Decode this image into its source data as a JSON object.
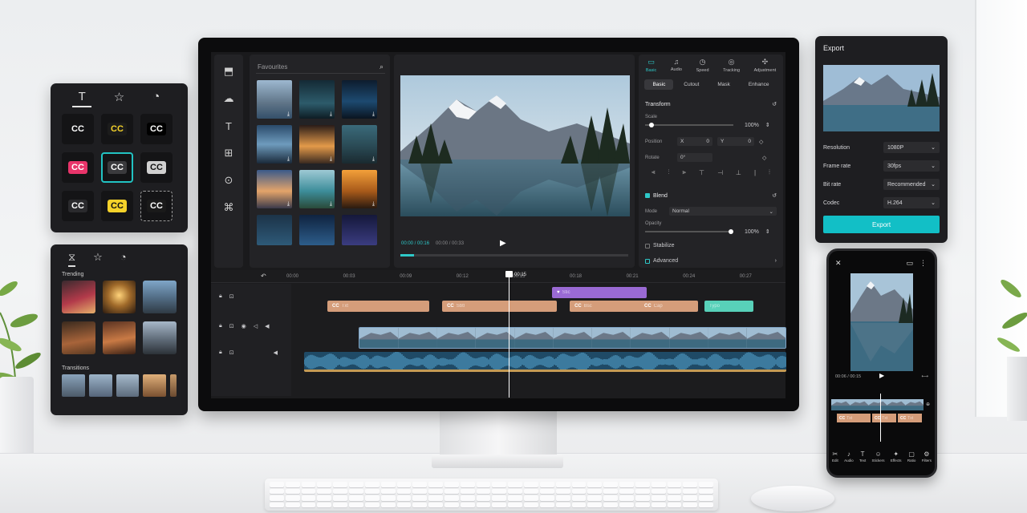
{
  "text_panel": {
    "tabs": [
      {
        "icon": "T"
      },
      {
        "icon": "☆"
      },
      {
        "icon": "◔"
      }
    ],
    "styles": [
      {
        "label": "CC",
        "bg": "#141416",
        "fg": "#ffffff"
      },
      {
        "label": "CC",
        "bg": "#1c1c1c",
        "fg": "#f5d22a"
      },
      {
        "label": "CC",
        "bg": "#000000",
        "fg": "#ffffff"
      },
      {
        "label": "CC",
        "bg": "#e8346a",
        "fg": "#ffffff"
      },
      {
        "label": "CC",
        "bg": "#3a3a3d",
        "fg": "#ffffff"
      },
      {
        "label": "CC",
        "bg": "#d0d0d0",
        "fg": "#111111"
      },
      {
        "label": "CC",
        "bg": "#2a2a2d",
        "fg": "#ffffff"
      },
      {
        "label": "CC",
        "bg": "#f5d22a",
        "fg": "#111111"
      },
      {
        "label": "CC",
        "bg": "#1a1a1a",
        "fg": "#ffffff"
      }
    ]
  },
  "effects_panel": {
    "tabs": [
      {
        "icon": "⧖"
      },
      {
        "icon": "☆"
      },
      {
        "icon": "◔"
      }
    ],
    "trending_label": "Trending",
    "transitions_label": "Transitions"
  },
  "media_panel": {
    "search_placeholder": "Favourites",
    "thumb_count": 15
  },
  "preview": {
    "current_time": "00:00 / 00:16",
    "total_time": "00:00 / 00:33",
    "progress": 0.06
  },
  "properties": {
    "tabs": [
      {
        "label": "Basic",
        "icon": "▭",
        "active": true
      },
      {
        "label": "Audio",
        "icon": "♫",
        "active": false
      },
      {
        "label": "Speed",
        "icon": "◷",
        "active": false
      },
      {
        "label": "Tracking",
        "icon": "◎",
        "active": false
      },
      {
        "label": "Adjustment",
        "icon": "✣",
        "active": false
      }
    ],
    "sub_tabs": [
      "Basic",
      "Cutout",
      "Mask",
      "Enhance"
    ],
    "transform_label": "Transform",
    "scale_label": "Scale",
    "scale_value": "100%",
    "scale_level": 0.05,
    "position_label": "Position",
    "pos_x_label": "X",
    "pos_x_value": "0",
    "pos_y_label": "Y",
    "pos_y_value": "0",
    "rotate_label": "Rotate",
    "rotate_value": "0°",
    "blend_label": "Blend",
    "mode_label": "Mode",
    "mode_value": "Normal",
    "opacity_label": "Opacity",
    "opacity_value": "100%",
    "opacity_level": 1.0,
    "stabilize_label": "Stabilize",
    "advanced_label": "Advanced"
  },
  "timeline": {
    "ticks": [
      "00:00",
      "00:03",
      "00:09",
      "00:12",
      "00:15",
      "00:18",
      "00:21",
      "00:24",
      "00:27"
    ],
    "playhead_time": "00:15",
    "text_clips": [
      {
        "label": "Txt",
        "start": 0.0,
        "end": 0.24
      },
      {
        "label": "Sbtl",
        "start": 0.27,
        "end": 0.54
      },
      {
        "label": "Bsc",
        "start": 0.57,
        "end": 0.86
      },
      {
        "label": "Cap",
        "start": 0.89,
        "end": 1.0
      }
    ],
    "sticker_clip": {
      "label": "Stic"
    },
    "teal_clip": {
      "label": "Typo"
    }
  },
  "export_panel": {
    "title": "Export",
    "resolution_label": "Resolution",
    "resolution_value": "1080P",
    "framerate_label": "Frame rate",
    "framerate_value": "30fps",
    "bitrate_label": "Bit rate",
    "bitrate_value": "Recommended",
    "codec_label": "Codec",
    "codec_value": "H.264",
    "export_button": "Export"
  },
  "phone": {
    "time": "00:06 / 00:15",
    "clips": [
      "Txt",
      "Txt",
      "Txt"
    ],
    "tools": [
      {
        "label": "Edit",
        "icon": "✂"
      },
      {
        "label": "Audio",
        "icon": "♪"
      },
      {
        "label": "Text",
        "icon": "T"
      },
      {
        "label": "Stickers",
        "icon": "☺"
      },
      {
        "label": "Effects",
        "icon": "✦"
      },
      {
        "label": "Ratio",
        "icon": "▢"
      },
      {
        "label": "Filters",
        "icon": "⚙"
      }
    ]
  }
}
